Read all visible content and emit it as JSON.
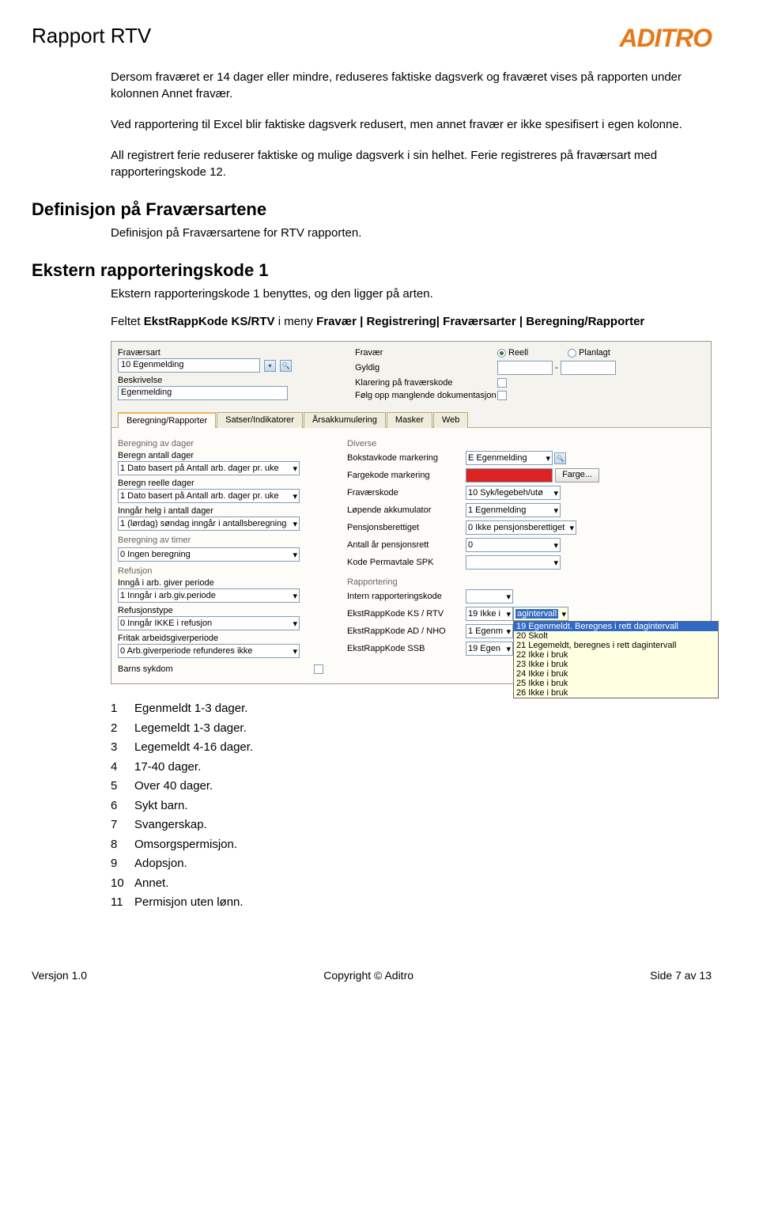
{
  "header": {
    "title": "Rapport RTV",
    "logo": "ADITRO"
  },
  "paragraphs": {
    "p1": "Dersom fraværet er 14 dager eller mindre, reduseres faktiske dagsverk og fraværet vises på rapporten under kolonnen Annet fravær.",
    "p2": "Ved rapportering til Excel blir faktiske dagsverk redusert, men annet fravær er ikke spesifisert i egen kolonne.",
    "p3": "All registrert ferie reduserer faktiske og mulige dagsverk i sin helhet. Ferie registreres på fraværsart med rapporteringskode 12."
  },
  "sections": {
    "s1_title": "Definisjon på Fraværsartene",
    "s1_text": "Definisjon på Fraværsartene for RTV rapporten.",
    "s2_title": "Ekstern rapporteringskode 1",
    "s2_text1": "Ekstern rapporteringskode 1 benyttes, og den ligger på arten.",
    "s2_text2a": "Feltet ",
    "s2_text2b": "EkstRappKode KS/RTV",
    "s2_text2c": " i meny ",
    "s2_text2d": "Fravær | Registrering| Fraværsarter | Beregning/Rapporter"
  },
  "form": {
    "top": {
      "fravaersart_label": "Fraværsart",
      "fravaersart_value": "10 Egenmelding",
      "beskrivelse_label": "Beskrivelse",
      "beskrivelse_value": "Egenmelding",
      "fravaer_label": "Fravær",
      "reell": "Reell",
      "planlagt": "Planlagt",
      "gyldig": "Gyldig",
      "klarering": "Klarering på fraværskode",
      "folgopp": "Følg opp manglende dokumentasjon"
    },
    "tabs": [
      "Beregning/Rapporter",
      "Satser/Indikatorer",
      "Årsakkumulering",
      "Masker",
      "Web"
    ],
    "left": {
      "grp1": "Beregning av dager",
      "f1l": "Beregn antall dager",
      "f1v": "1 Dato basert på Antall arb. dager pr. uke",
      "f2l": "Beregn reelle dager",
      "f2v": "1 Dato basert på Antall arb. dager pr. uke",
      "f3l": "Inngår helg i antall dager",
      "f3v": "1 (lørdag) søndag inngår i antallsberegning",
      "grp2": "Beregning av timer",
      "f4v": "0 Ingen beregning",
      "grp3": "Refusjon",
      "f5l": "Inngå i arb. giver periode",
      "f5v": "1 Inngår i arb.giv.periode",
      "f6l": "Refusjonstype",
      "f6v": "0 Inngår IKKE i refusjon",
      "f7l": "Fritak arbeidsgiverperiode",
      "f7v": "0 Arb.giverperiode refunderes ikke",
      "f8l": "Barns sykdom"
    },
    "right": {
      "grp1": "Diverse",
      "r1l": "Bokstavkode markering",
      "r1v": "E Egenmelding",
      "r2l": "Fargekode markering",
      "r2btn": "Farge...",
      "r3l": "Fraværskode",
      "r3v": "10 Syk/legebeh/utø",
      "r4l": "Løpende akkumulator",
      "r4v": "1 Egenmelding",
      "r5l": "Pensjonsberettiget",
      "r5v": "0 Ikke pensjonsberettiget",
      "r6l": "Antall år pensjonsrett",
      "r6v": "0",
      "r7l": "Kode Permavtale SPK",
      "grp2": "Rapportering",
      "r8l": "Intern rapporteringskode",
      "r9l": "EkstRappKode KS / RTV",
      "r9v": "19 Ikke i",
      "r10l": "EkstRappKode AD / NHO",
      "r10v": "1 Egenm",
      "r11l": "EkstRappKode SSB",
      "r11v": "19 Egen",
      "dropdown": {
        "sel": "19 Egenmeldt. Beregnes i rett dagintervall",
        "items": [
          "agintervall",
          "20 Skolt",
          "21 Legemeldt, beregnes i rett dagintervall",
          "22 Ikke i bruk",
          "23 Ikke i bruk",
          "24 Ikke i bruk",
          "25 Ikke i bruk",
          "26 Ikke i bruk"
        ]
      }
    }
  },
  "list": [
    {
      "n": "1",
      "t": "Egenmeldt 1-3 dager."
    },
    {
      "n": "2",
      "t": "Legemeldt 1-3 dager."
    },
    {
      "n": "3",
      "t": "Legemeldt 4-16 dager."
    },
    {
      "n": "4",
      "t": "17-40 dager."
    },
    {
      "n": "5",
      "t": "Over 40 dager."
    },
    {
      "n": "6",
      "t": "Sykt barn."
    },
    {
      "n": "7",
      "t": "Svangerskap."
    },
    {
      "n": "8",
      "t": "Omsorgspermisjon."
    },
    {
      "n": "9",
      "t": "Adopsjon."
    },
    {
      "n": "10",
      "t": "Annet."
    },
    {
      "n": "11",
      "t": "Permisjon uten lønn."
    }
  ],
  "footer": {
    "version": "Versjon 1.0",
    "copyright": "Copyright © Aditro",
    "page": "Side 7 av 13"
  }
}
